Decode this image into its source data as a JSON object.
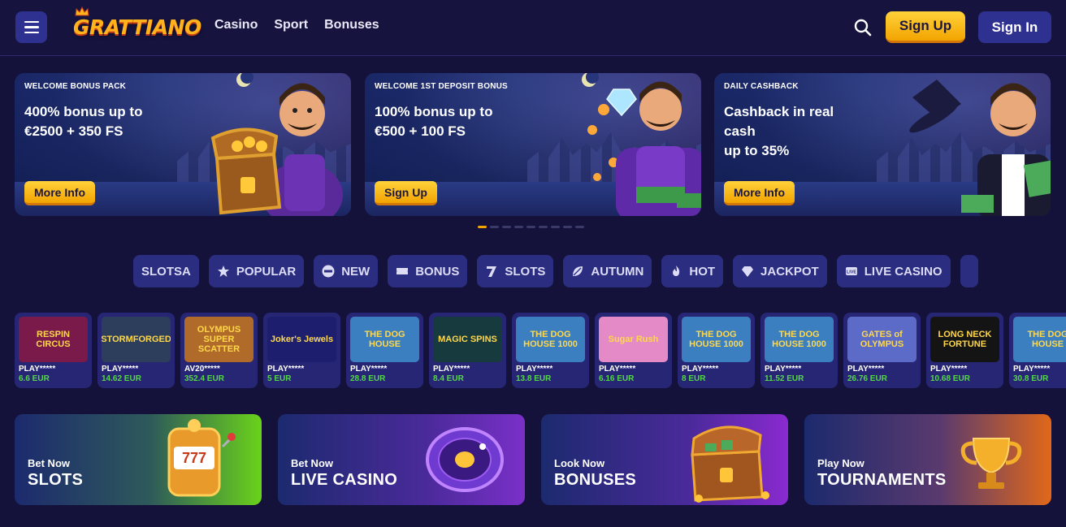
{
  "header": {
    "logo_text": "GRATTIANO",
    "nav": [
      "Casino",
      "Sport",
      "Bonuses"
    ],
    "signup_label": "Sign Up",
    "signin_label": "Sign In"
  },
  "banners": [
    {
      "kicker": "WELCOME BONUS PACK",
      "headline_l1": "400% bonus up to",
      "headline_l2": "€2500 + 350 FS",
      "headline_l3": "",
      "cta": "More Info"
    },
    {
      "kicker": "WELCOME 1ST DEPOSIT BONUS",
      "headline_l1": "100% bonus up to",
      "headline_l2": "€500 + 100 FS",
      "headline_l3": "",
      "cta": "Sign Up"
    },
    {
      "kicker": "DAILY CASHBACK",
      "headline_l1": "Cashback in real",
      "headline_l2": "cash",
      "headline_l3": "up to 35%",
      "cta": "More Info"
    }
  ],
  "carousel": {
    "total": 9,
    "active": 0
  },
  "chips": [
    "SLOTSA",
    "POPULAR",
    "NEW",
    "BONUS",
    "SLOTS",
    "AUTUMN",
    "HOT",
    "JACKPOT",
    "LIVE CASINO"
  ],
  "games": [
    {
      "title": "RESPIN CIRCUS",
      "player": "PLAY*****",
      "amount": "6.6 EUR",
      "bg": "#7a1a4a"
    },
    {
      "title": "STORMFORGED",
      "player": "PLAY*****",
      "amount": "14.62 EUR",
      "bg": "#2c3e5c"
    },
    {
      "title": "OLYMPUS SUPER SCATTER",
      "player": "AV20*****",
      "amount": "352.4 EUR",
      "bg": "#b06a2a"
    },
    {
      "title": "Joker's Jewels",
      "player": "PLAY*****",
      "amount": "5 EUR",
      "bg": "#1d1f6e"
    },
    {
      "title": "THE DOG HOUSE",
      "player": "PLAY*****",
      "amount": "28.8 EUR",
      "bg": "#3c7fc0"
    },
    {
      "title": "MAGIC SPINS",
      "player": "PLAY*****",
      "amount": "8.4 EUR",
      "bg": "#173a3f"
    },
    {
      "title": "THE DOG HOUSE 1000",
      "player": "PLAY*****",
      "amount": "13.8 EUR",
      "bg": "#3c7fc0"
    },
    {
      "title": "Sugar Rush",
      "player": "PLAY*****",
      "amount": "6.16 EUR",
      "bg": "#e48ac7"
    },
    {
      "title": "THE DOG HOUSE 1000",
      "player": "PLAY*****",
      "amount": "8 EUR",
      "bg": "#3c7fc0"
    },
    {
      "title": "THE DOG HOUSE 1000",
      "player": "PLAY*****",
      "amount": "11.52 EUR",
      "bg": "#3c7fc0"
    },
    {
      "title": "GATES of OLYMPUS",
      "player": "PLAY*****",
      "amount": "26.76 EUR",
      "bg": "#5b6bc7"
    },
    {
      "title": "LONG NECK FORTUNE",
      "player": "PLAY*****",
      "amount": "10.68 EUR",
      "bg": "#141414"
    },
    {
      "title": "THE DOG HOUSE",
      "player": "PLAY*****",
      "amount": "30.8 EUR",
      "bg": "#3c7fc0"
    }
  ],
  "cards": [
    {
      "sub": "Bet Now",
      "big": "SLOTS"
    },
    {
      "sub": "Bet Now",
      "big": "LIVE CASINO"
    },
    {
      "sub": "Look Now",
      "big": "BONUSES"
    },
    {
      "sub": "Play Now",
      "big": "TOURNAMENTS"
    }
  ],
  "colors": {
    "bg": "#14123a",
    "accent": "#f2a400",
    "chip": "#2b2d80",
    "win": "#55d64a"
  }
}
